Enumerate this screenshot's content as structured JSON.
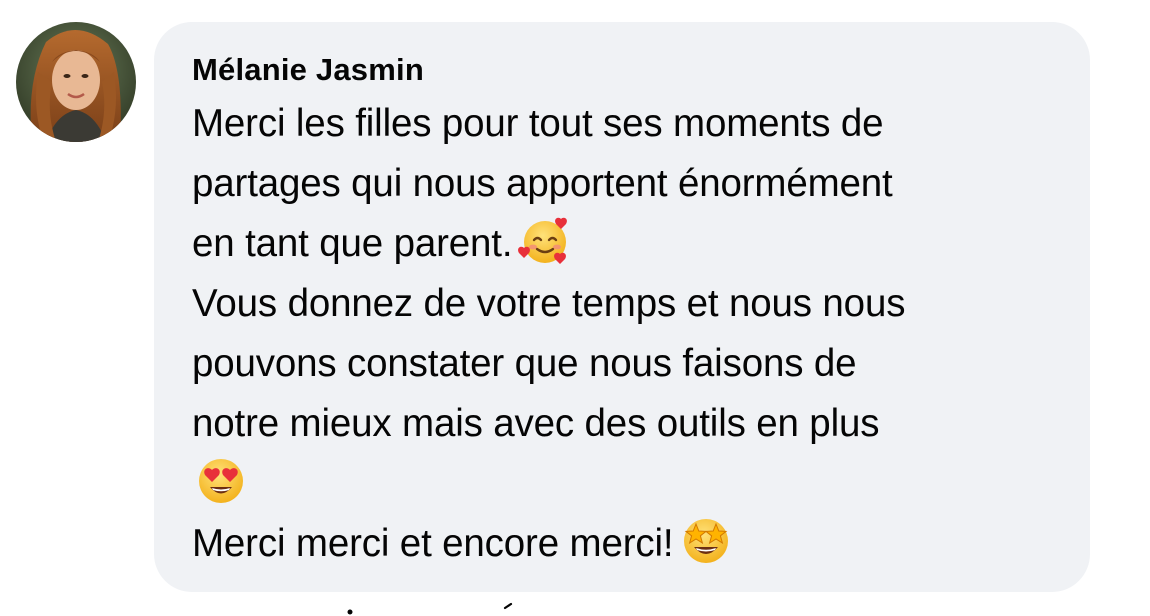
{
  "comment": {
    "author": "Mélanie Jasmin",
    "lines": [
      "Merci les filles pour tout ses moments de",
      "partages qui nous apportent énormément",
      "en tant que parent.",
      "Vous donnez de votre temps et nous nous",
      "pouvons constater que nous faisons de",
      "notre mieux mais avec des outils en plus",
      "",
      "Merci merci et encore merci!"
    ],
    "emojis": {
      "line3": "smiling-face-with-hearts-icon",
      "line7": "heart-eyes-icon",
      "line8": "star-struck-icon"
    }
  },
  "colors": {
    "bubble_background": "#f0f2f5",
    "text": "#050505"
  }
}
